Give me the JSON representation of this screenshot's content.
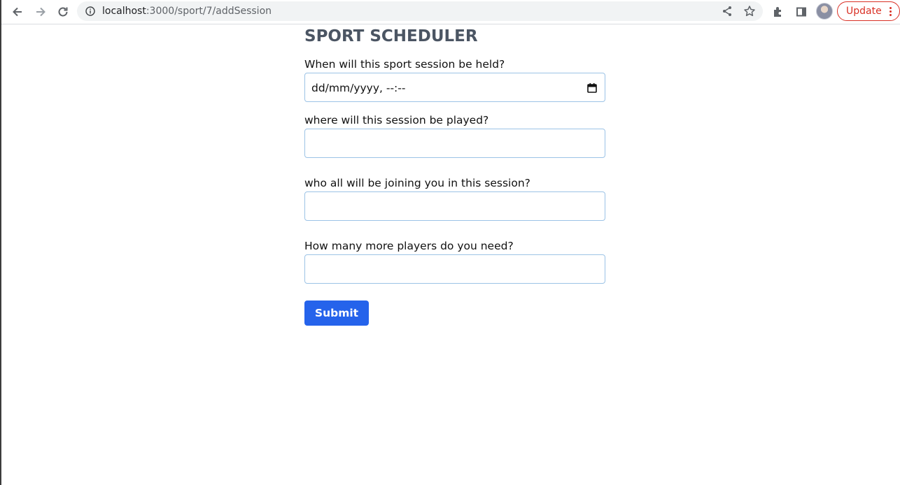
{
  "browser": {
    "url_host": "localhost",
    "url_path": ":3000/sport/7/addSession",
    "update_label": "Update",
    "icons": [
      "back-icon",
      "forward-icon",
      "reload-icon",
      "info-icon",
      "share-icon",
      "star-icon",
      "extensions-icon",
      "side-panel-icon",
      "profile-avatar",
      "more-icon"
    ]
  },
  "page": {
    "title": "SPORT SCHEDULER",
    "fields": [
      {
        "label": "When will this sport session be held?",
        "placeholder": "dd/mm/yyyy, --:--",
        "type": "datetime-local"
      },
      {
        "label": "where will this session be played?",
        "value": ""
      },
      {
        "label": "who all will be joining you in this session?",
        "value": ""
      },
      {
        "label": "How many more players do you need?",
        "value": ""
      }
    ],
    "submit_label": "Submit"
  },
  "colors": {
    "accent": "#2563eb",
    "title": "#4b5563",
    "field_border": "#9cc3e6",
    "update": "#d93025"
  }
}
